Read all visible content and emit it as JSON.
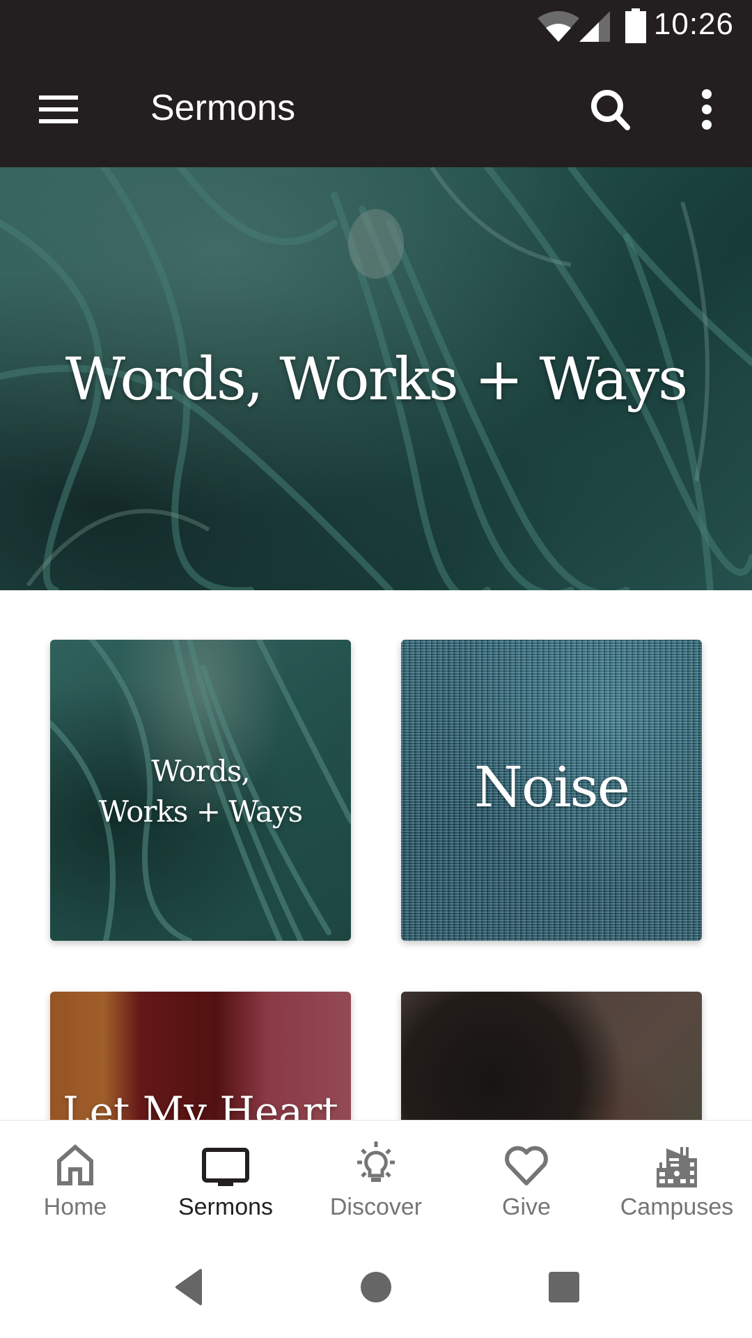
{
  "status_bar": {
    "time": "10:26",
    "icons": [
      "wifi-icon",
      "cellular-signal-icon",
      "battery-icon"
    ]
  },
  "app_bar": {
    "title": "Sermons",
    "menu_icon": "hamburger-menu-icon",
    "search_icon": "search-icon",
    "more_icon": "more-vertical-icon"
  },
  "hero": {
    "title": "Words, Works + Ways"
  },
  "series_cards": [
    {
      "title_line1": "Words,",
      "title_line2": "Works + Ways"
    },
    {
      "title": "Noise"
    },
    {
      "title": "Let My Heart"
    },
    {
      "title": ""
    }
  ],
  "bottom_nav": {
    "items": [
      {
        "label": "Home",
        "icon": "home-icon",
        "active": false
      },
      {
        "label": "Sermons",
        "icon": "tv-icon",
        "active": true
      },
      {
        "label": "Discover",
        "icon": "lightbulb-icon",
        "active": false
      },
      {
        "label": "Give",
        "icon": "heart-icon",
        "active": false
      },
      {
        "label": "Campuses",
        "icon": "building-icon",
        "active": false
      }
    ]
  },
  "system_nav": {
    "buttons": [
      "back",
      "home",
      "recents"
    ]
  },
  "colors": {
    "app_bar_bg": "#231f20",
    "nav_active": "#231f20",
    "nav_inactive": "#757575",
    "system_icons": "#666666"
  }
}
